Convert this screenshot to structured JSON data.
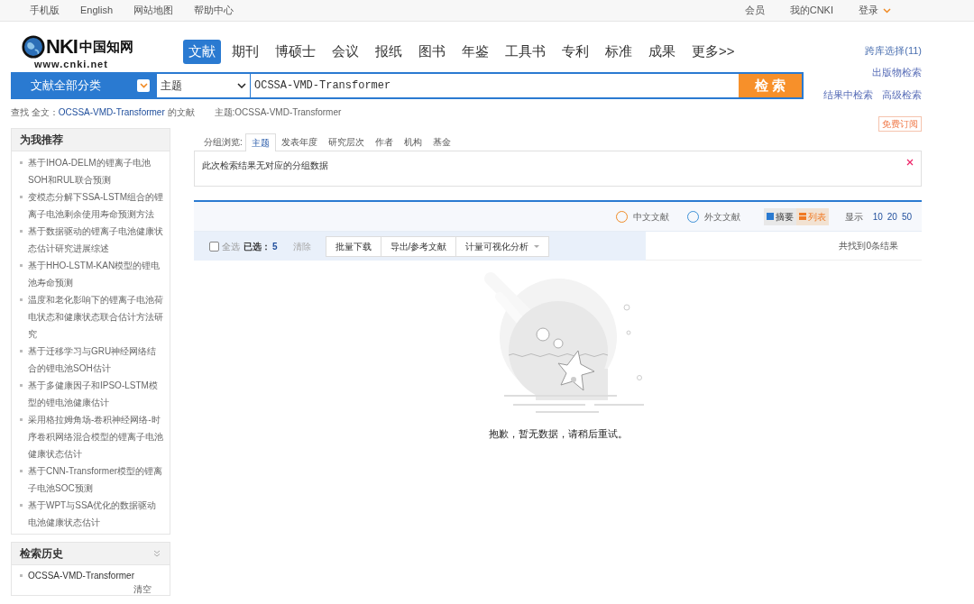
{
  "top_bar": {
    "left_links": [
      "手机版",
      "English",
      "网站地图",
      "帮助中心"
    ],
    "right_links": [
      "会员",
      "我的CNKI",
      "登录"
    ]
  },
  "logo": {
    "mark": "NKI",
    "name": "中国知网",
    "url": "www.cnki.net"
  },
  "nav_tabs": [
    {
      "label": "文献",
      "selected": true
    },
    {
      "label": "期刊",
      "selected": false
    },
    {
      "label": "博硕士",
      "selected": false
    },
    {
      "label": "会议",
      "selected": false
    },
    {
      "label": "报纸",
      "selected": false
    },
    {
      "label": "图书",
      "selected": false
    },
    {
      "label": "年鉴",
      "selected": false
    },
    {
      "label": "工具书",
      "selected": false
    },
    {
      "label": "专利",
      "selected": false
    },
    {
      "label": "标准",
      "selected": false
    },
    {
      "label": "成果",
      "selected": false
    },
    {
      "label": "更多>>",
      "selected": false
    }
  ],
  "side_links": [
    "跨库选择(11)",
    "出版物检索",
    "结果中检索",
    "高级检索"
  ],
  "search": {
    "category": "文献全部分类",
    "field": "主题",
    "value": "OCSSA-VMD-Transformer",
    "button": "检 索"
  },
  "query_summary": {
    "prefix": "查找 全文：",
    "term": "OCSSA-VMD-Transformer",
    "suffix": " 的文献",
    "topic": "主题:OCSSA-VMD-Transformer"
  },
  "recommend": {
    "title": "为我推荐",
    "items": [
      "基于IHOA-DELM的锂离子电池SOH和RUL联合预测",
      "变模态分解下SSA-LSTM组合的锂离子电池剩余使用寿命预测方法",
      "基于数据驱动的锂离子电池健康状态估计研究进展综述",
      "基于HHO-LSTM-KAN模型的锂电池寿命预测",
      "温度和老化影响下的锂离子电池荷电状态和健康状态联合估计方法研究",
      "基于迁移学习与GRU神经网络结合的锂电池SOH估计",
      "基于多健康因子和IPSO-LSTM模型的锂电池健康估计",
      "采用格拉姆角场-卷积神经网络-时序卷积网络混合模型的锂离子电池健康状态估计",
      "基于CNN-Transformer模型的锂离子电池SOC预测",
      "基于WPT与SSA优化的数据驱动电池健康状态估计"
    ]
  },
  "history": {
    "title": "检索历史",
    "items": [
      "OCSSA-VMD-Transformer"
    ],
    "clear": "清空"
  },
  "subscribe": "免费订阅",
  "group_browse": {
    "label": "分组浏览:",
    "tabs": [
      {
        "label": "主题",
        "selected": true
      },
      {
        "label": "发表年度",
        "selected": false
      },
      {
        "label": "研究层次",
        "selected": false
      },
      {
        "label": "作者",
        "selected": false
      },
      {
        "label": "机构",
        "selected": false
      },
      {
        "label": "基金",
        "selected": false
      }
    ],
    "message": "此次检索结果无对应的分组数据"
  },
  "results_toolbar": {
    "languages": [
      "中文文献",
      "外文文献"
    ],
    "views": [
      {
        "label": "摘要",
        "selected": false
      },
      {
        "label": "列表",
        "selected": true
      }
    ],
    "show_label": "显示",
    "page_sizes": [
      "10",
      "20",
      "50"
    ]
  },
  "actions": {
    "select_all": {
      "label": "全选",
      "checked": false
    },
    "selected_label": "已选：",
    "selected_count": "5",
    "clear": "清除",
    "buttons": [
      "批量下载",
      "导出/参考文献",
      "计量可视化分析"
    ],
    "result_count": "共找到0条结果"
  },
  "empty_message": "抱歉，暂无数据，请稍后重试。"
}
